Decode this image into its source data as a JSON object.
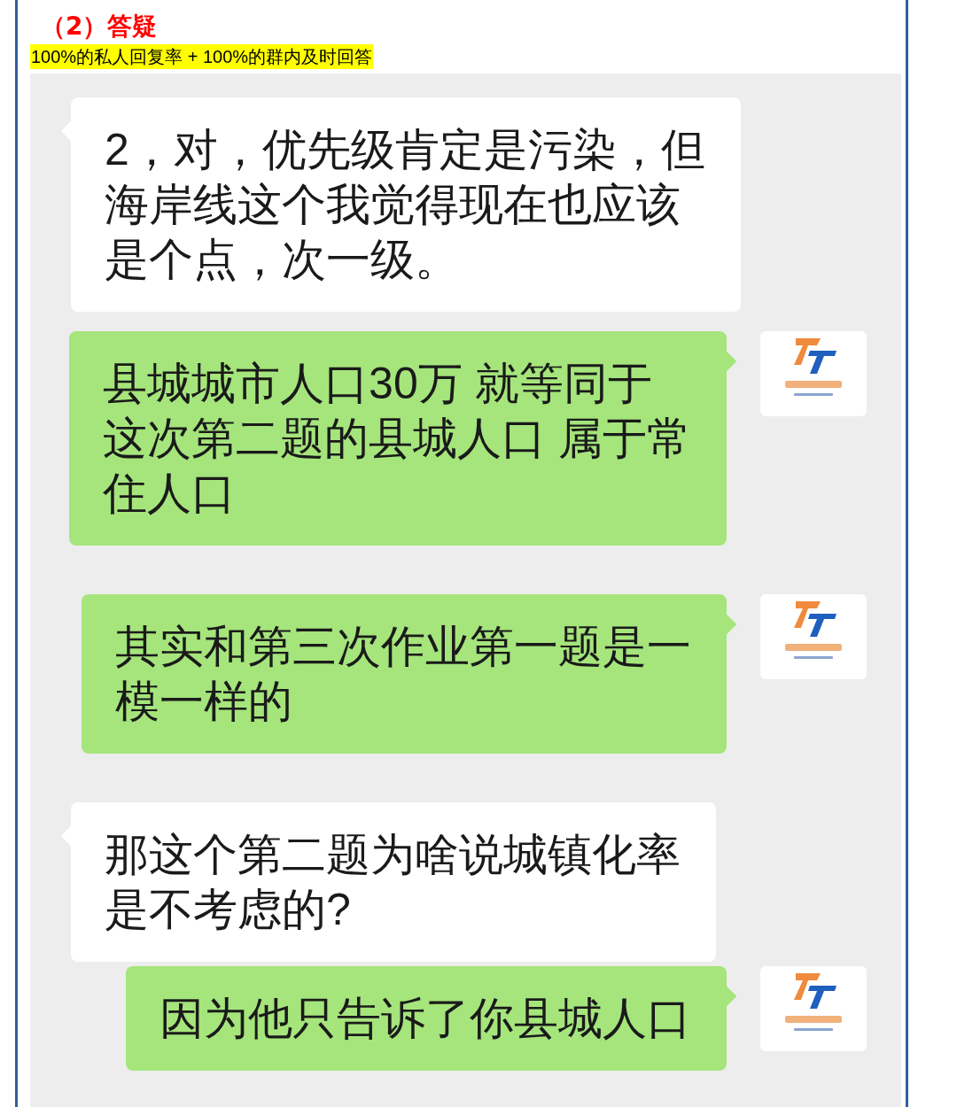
{
  "heading": "（2）答疑",
  "highlight": "100%的私人回复率 + 100%的群内及时回答",
  "messages": [
    {
      "kind": "incoming",
      "lines": [
        "2，对，优先级肯定是污染，但",
        "海岸线这个我觉得现在也应该",
        "是个点，次一级。"
      ]
    },
    {
      "kind": "outgoing",
      "lines": [
        "县城城市人口30万  就等同于",
        "这次第二题的县城人口  属于常",
        "住人口"
      ]
    },
    {
      "kind": "outgoing",
      "lines": [
        "其实和第三次作业第一题是一",
        "模一样的"
      ]
    },
    {
      "kind": "incoming",
      "lines": [
        "那这个第二题为啥说城镇化率",
        "是不考虑的?"
      ]
    },
    {
      "kind": "outgoing",
      "lines": [
        "因为他只告诉了你县城人口"
      ]
    }
  ]
}
